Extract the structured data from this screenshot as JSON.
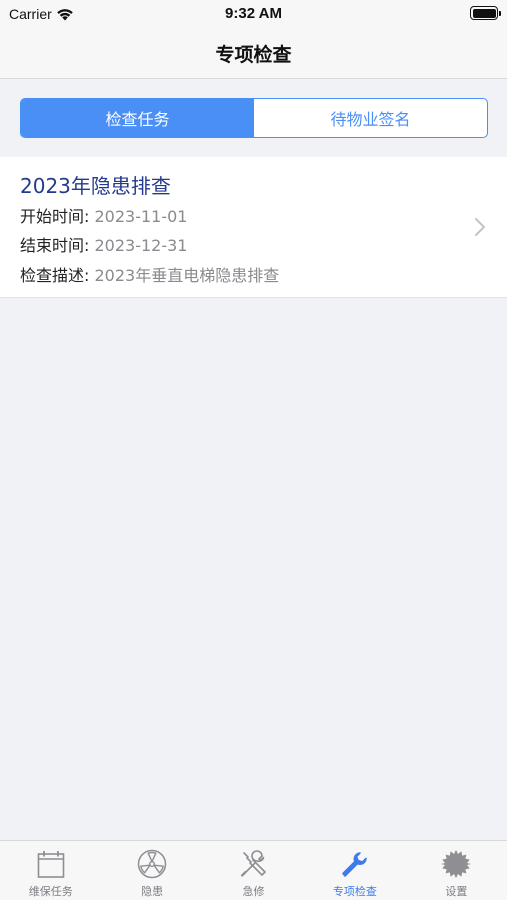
{
  "status_bar": {
    "carrier": "Carrier",
    "time": "9:32 AM"
  },
  "nav": {
    "title": "专项检查"
  },
  "segments": [
    {
      "label": "检查任务",
      "active": true
    },
    {
      "label": "待物业签名",
      "active": false
    }
  ],
  "tasks": [
    {
      "title": "2023年隐患排查",
      "start_label": "开始时间:",
      "start_value": "2023-11-01",
      "end_label": "结束时间:",
      "end_value": "2023-12-31",
      "desc_label": "检查描述:",
      "desc_value": "2023年垂直电梯隐患排查"
    }
  ],
  "tabs": [
    {
      "label": "维保任务",
      "icon": "calendar-icon",
      "active": false
    },
    {
      "label": "隐患",
      "icon": "radiation-icon",
      "active": false
    },
    {
      "label": "急修",
      "icon": "tools-icon",
      "active": false
    },
    {
      "label": "专项检查",
      "icon": "wrench-icon",
      "active": true
    },
    {
      "label": "设置",
      "icon": "gear-icon",
      "active": false
    }
  ],
  "colors": {
    "accent": "#4a8ff6",
    "tab_active": "#3d7bea",
    "title_blue": "#253a8f"
  }
}
